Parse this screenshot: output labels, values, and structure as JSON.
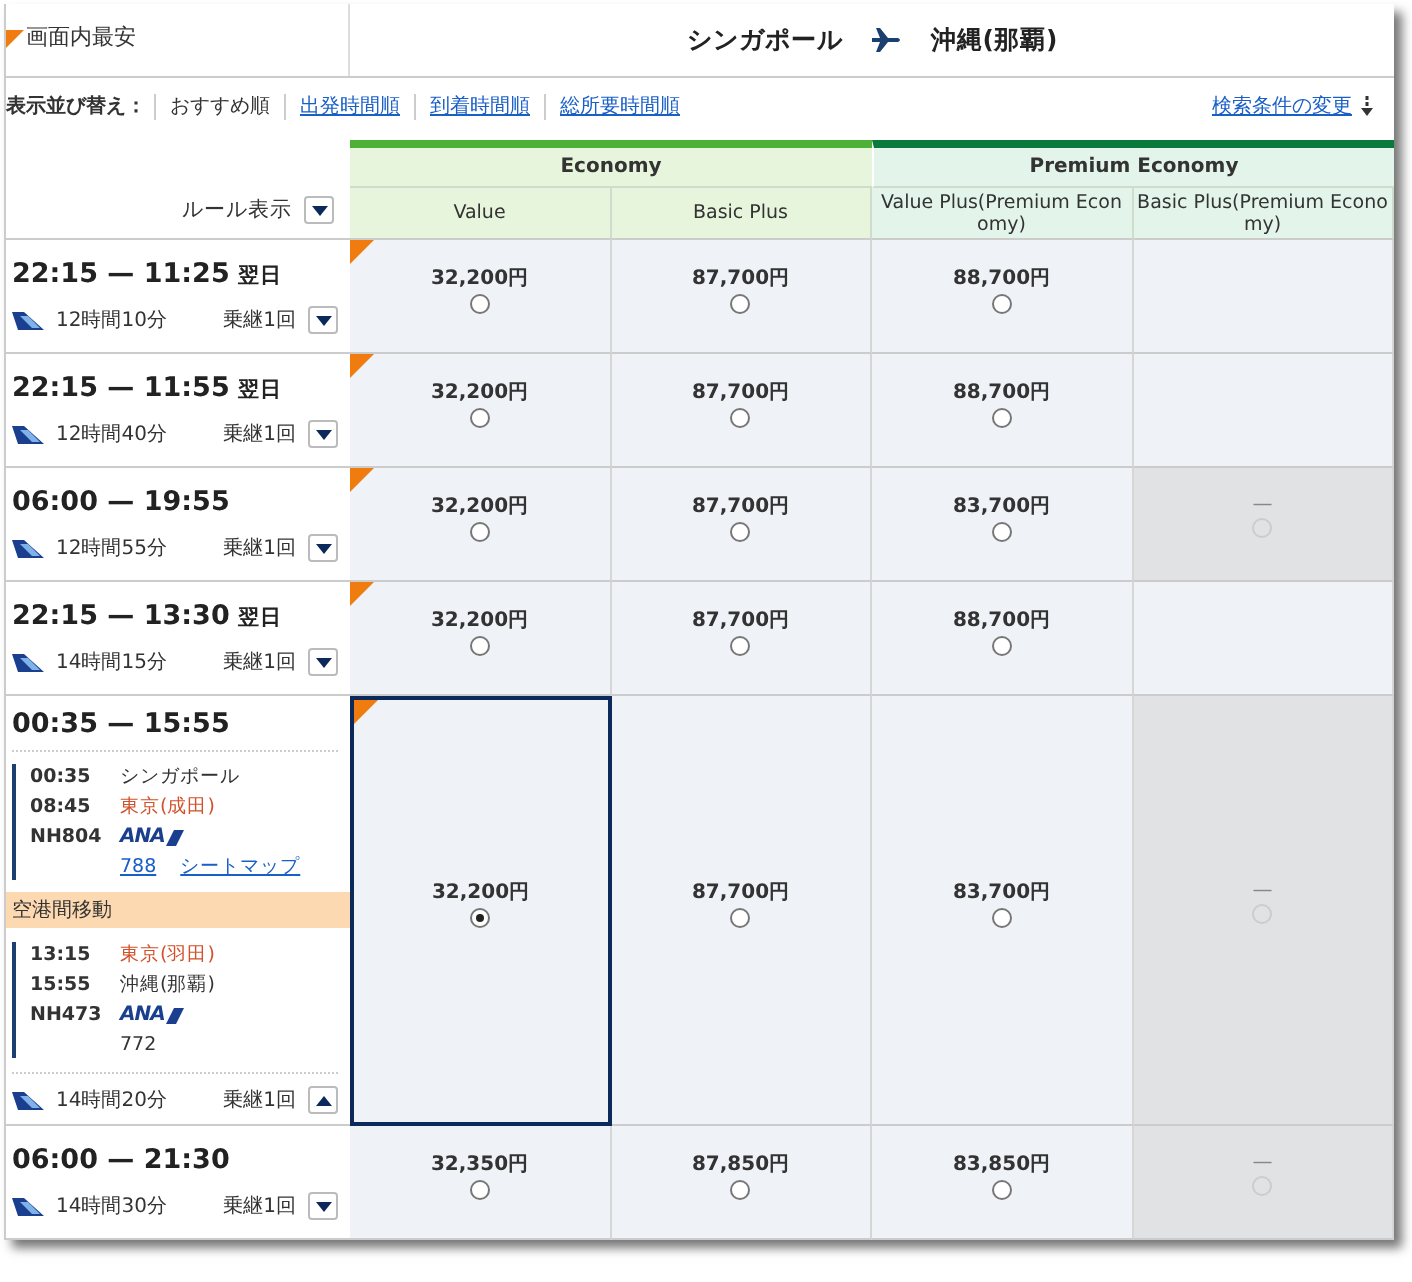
{
  "legend": {
    "label": "画面内最安"
  },
  "route": {
    "origin": "シンガポール",
    "destination": "沖縄(那覇)"
  },
  "sort": {
    "label": "表示並び替え：",
    "options": [
      {
        "label": "おすすめ順",
        "selected": true
      },
      {
        "label": "出発時間順",
        "selected": false
      },
      {
        "label": "到着時間順",
        "selected": false
      },
      {
        "label": "総所要時間順",
        "selected": false
      }
    ]
  },
  "change_search": {
    "label": "検索条件の変更"
  },
  "rules": {
    "label": "ルール表示"
  },
  "fare_groups": [
    {
      "name": "Economy",
      "color": "#4db137",
      "fares": [
        "Value",
        "Basic Plus"
      ]
    },
    {
      "name": "Premium Economy",
      "color": "#0a7a3c",
      "fares": [
        "Value Plus(Premium Economy)",
        "Basic Plus(Premium Economy)"
      ]
    }
  ],
  "flights": [
    {
      "times": "22:15 — 11:25",
      "next_day": "翌日",
      "duration": "12時間10分",
      "stops": "乗継1回",
      "expanded": false,
      "fares": [
        {
          "kind": "price",
          "price": "32,200円",
          "cheapest": true,
          "selected": false
        },
        {
          "kind": "price",
          "price": "87,700円",
          "cheapest": false,
          "selected": false
        },
        {
          "kind": "price",
          "price": "88,700円",
          "cheapest": false,
          "selected": false
        },
        {
          "kind": "empty"
        }
      ]
    },
    {
      "times": "22:15 — 11:55",
      "next_day": "翌日",
      "duration": "12時間40分",
      "stops": "乗継1回",
      "expanded": false,
      "fares": [
        {
          "kind": "price",
          "price": "32,200円",
          "cheapest": true,
          "selected": false
        },
        {
          "kind": "price",
          "price": "87,700円",
          "cheapest": false,
          "selected": false
        },
        {
          "kind": "price",
          "price": "88,700円",
          "cheapest": false,
          "selected": false
        },
        {
          "kind": "empty"
        }
      ]
    },
    {
      "times": "06:00 — 19:55",
      "duration": "12時間55分",
      "stops": "乗継1回",
      "expanded": false,
      "fares": [
        {
          "kind": "price",
          "price": "32,200円",
          "cheapest": true,
          "selected": false
        },
        {
          "kind": "price",
          "price": "87,700円",
          "cheapest": false,
          "selected": false
        },
        {
          "kind": "price",
          "price": "83,700円",
          "cheapest": false,
          "selected": false
        },
        {
          "kind": "unavailable",
          "text": "—",
          "disabled": true
        }
      ]
    },
    {
      "times": "22:15 — 13:30",
      "next_day": "翌日",
      "duration": "14時間15分",
      "stops": "乗継1回",
      "expanded": false,
      "fares": [
        {
          "kind": "price",
          "price": "32,200円",
          "cheapest": true,
          "selected": false
        },
        {
          "kind": "price",
          "price": "87,700円",
          "cheapest": false,
          "selected": false
        },
        {
          "kind": "price",
          "price": "88,700円",
          "cheapest": false,
          "selected": false
        },
        {
          "kind": "empty"
        }
      ]
    },
    {
      "times": "00:35 — 15:55",
      "duration": "14時間20分",
      "stops": "乗継1回",
      "expanded": true,
      "legs": [
        {
          "kind": "flight",
          "depart_time": "00:35",
          "depart_station": "シンガポール",
          "depart_highlight": false,
          "arrive_time": "08:45",
          "arrive_station": "東京(成田)",
          "arrive_highlight": true,
          "flight_no": "NH804",
          "airline": "ANA",
          "aircraft": "788",
          "aircraft_link": true,
          "seat_map": "シートマップ"
        },
        {
          "kind": "transfer",
          "label": "空港間移動"
        },
        {
          "kind": "flight",
          "depart_time": "13:15",
          "depart_station": "東京(羽田)",
          "depart_highlight": true,
          "arrive_time": "15:55",
          "arrive_station": "沖縄(那覇)",
          "arrive_highlight": false,
          "flight_no": "NH473",
          "airline": "ANA",
          "aircraft": "772",
          "aircraft_link": false
        }
      ],
      "fares": [
        {
          "kind": "price",
          "price": "32,200円",
          "cheapest": true,
          "selected": true
        },
        {
          "kind": "price",
          "price": "87,700円",
          "cheapest": false,
          "selected": false
        },
        {
          "kind": "price",
          "price": "83,700円",
          "cheapest": false,
          "selected": false
        },
        {
          "kind": "unavailable",
          "text": "—",
          "disabled": true
        }
      ]
    },
    {
      "times": "06:00 — 21:30",
      "duration": "14時間30分",
      "stops": "乗継1回",
      "expanded": false,
      "fares": [
        {
          "kind": "price",
          "price": "32,350円",
          "cheapest": false,
          "selected": false
        },
        {
          "kind": "price",
          "price": "87,850円",
          "cheapest": false,
          "selected": false
        },
        {
          "kind": "price",
          "price": "83,850円",
          "cheapest": false,
          "selected": false
        },
        {
          "kind": "unavailable",
          "text": "—",
          "disabled": true
        }
      ]
    }
  ]
}
